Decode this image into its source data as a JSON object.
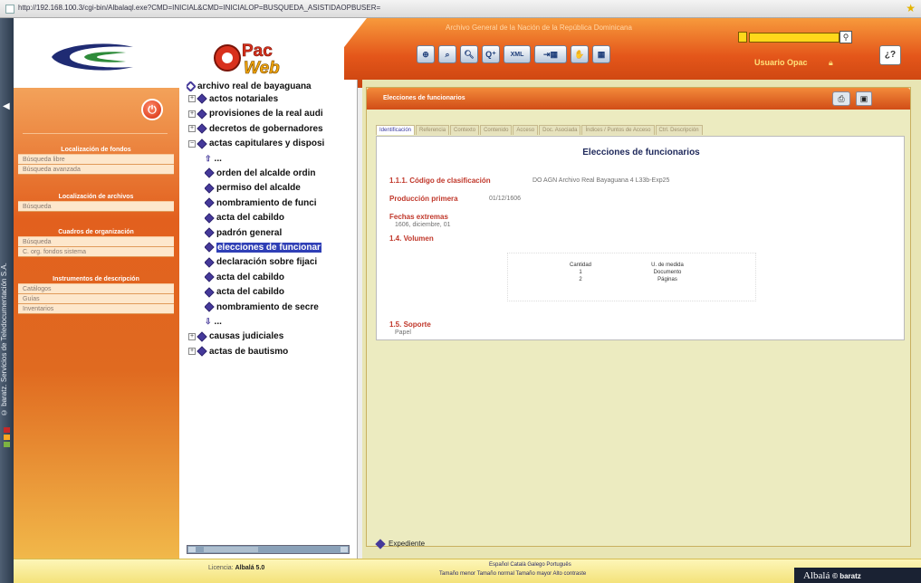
{
  "browser": {
    "url": "http://192.168.100.3/cgi-bin/Albalaql.exe?CMD=INICIAL&CMD=INICIALOP=BUSQUEDA_ASISTIDAOPBUSER="
  },
  "header": {
    "institution": "Archivo General de la Nación de la República Dominicana",
    "logo_text": "Pac Web",
    "user_label": "Usuario Opac",
    "help_label": "¿?",
    "toolbar": [
      "search-form-icon",
      "tree-search-icon",
      "search-icon",
      "advanced-search-icon",
      "xml-icon",
      "export-icon",
      "hand-icon",
      "grid-icon"
    ],
    "toolbar_xml_label": "XML"
  },
  "sidebar": {
    "sections": [
      {
        "title": "Localización de fondos",
        "items": [
          "Búsqueda libre",
          "Búsqueda avanzada"
        ]
      },
      {
        "title": "Localización de archivos",
        "items": [
          "Búsqueda"
        ]
      },
      {
        "title": "Cuadros de organización",
        "items": [
          "Búsqueda",
          "C. org. fondos sistema"
        ]
      },
      {
        "title": "Instrumentos de descripción",
        "items": [
          "Catálogos",
          "Guías",
          "Inventarios"
        ]
      }
    ]
  },
  "vertical_text": "© baratz. Servicios de Teledocumentación S.A.",
  "tree": {
    "root": "archivo real de bayaguana",
    "nodes": [
      {
        "label": "actos notariales",
        "level": 1,
        "expander": "+"
      },
      {
        "label": "provisiones de la real audi",
        "level": 1,
        "expander": "+"
      },
      {
        "label": "decretos de gobernadores",
        "level": 1,
        "expander": "+"
      },
      {
        "label": "actas capitulares y disposi",
        "level": 1,
        "expander": "-"
      },
      {
        "label": "...",
        "level": 2,
        "expander": "up"
      },
      {
        "label": "orden del alcalde ordin",
        "level": 2,
        "expander": ""
      },
      {
        "label": "permiso del alcalde",
        "level": 2,
        "expander": ""
      },
      {
        "label": "nombramiento de funci",
        "level": 2,
        "expander": ""
      },
      {
        "label": "acta del cabildo",
        "level": 2,
        "expander": ""
      },
      {
        "label": "padrón general",
        "level": 2,
        "expander": ""
      },
      {
        "label": "elecciones de funcionar",
        "level": 2,
        "expander": "",
        "selected": true
      },
      {
        "label": "declaración sobre fijaci",
        "level": 2,
        "expander": ""
      },
      {
        "label": "acta del cabildo",
        "level": 2,
        "expander": ""
      },
      {
        "label": "acta del cabildo",
        "level": 2,
        "expander": ""
      },
      {
        "label": "nombramiento de secre",
        "level": 2,
        "expander": ""
      },
      {
        "label": "...",
        "level": 2,
        "expander": "down"
      },
      {
        "label": "causas judiciales",
        "level": 1,
        "expander": "+"
      },
      {
        "label": "actas de bautismo",
        "level": 1,
        "expander": "+"
      }
    ]
  },
  "record": {
    "panel_title": "Elecciones de funcionarios",
    "tabs": [
      "Identificación",
      "Referencia",
      "Contexto",
      "Contenido",
      "Acceso",
      "Doc. Asociada",
      "Índices / Puntos de Acceso",
      "Ctrl. Descripción"
    ],
    "active_tab": "Identificación",
    "title": "Elecciones de funcionarios",
    "code_label": "1.1.1. Código de clasificación",
    "code_value": "DO AGN Archivo Real Bayaguana 4 L33b-Exp25",
    "produccion_label": "Producción primera",
    "produccion_value": "01/12/1606",
    "fechas_label": "Fechas extremas",
    "fechas_value": "1606, diciembre, 01",
    "volumen_label": "1.4. Volumen",
    "volumen_cols": [
      "Cantidad",
      "U. de medida"
    ],
    "volumen_rows": [
      [
        "1",
        "Documento"
      ],
      [
        "2",
        "Páginas"
      ]
    ],
    "soporte_label": "1.5. Soporte",
    "soporte_value": "Papel",
    "expediente_label": "Expediente"
  },
  "footer": {
    "licencia_label": "Licencia:",
    "licencia_value": "Albalá 5.0",
    "languages": "Español  Català  Galego  Português",
    "sizes": "Tamaño menor  Tamaño normal  Tamaño mayor  Alto contraste",
    "brand": "Albalá",
    "brand_company": "© baratz"
  },
  "colors": {
    "header_orange": "#e4561a",
    "sidebar_orange": "#e2601e",
    "search_yellow": "#ffd81b",
    "label_red": "#c0372a",
    "title_navy": "#202a5c",
    "content_bg": "#e8e5b4"
  }
}
